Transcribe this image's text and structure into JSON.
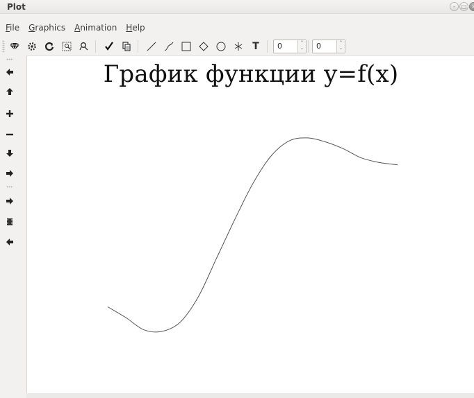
{
  "window": {
    "title": "Plot"
  },
  "menu": [
    "File",
    "Graphics",
    "Animation",
    "Help"
  ],
  "toolbar": {
    "spin1_value": "0",
    "spin2_value": "0",
    "text_tool_label": "T"
  },
  "plot": {
    "title": "График функции y=f(x)",
    "line_color": "#555555"
  },
  "chart_data": {
    "type": "line",
    "title": "График функции y=f(x)",
    "xlabel": "",
    "ylabel": "",
    "grid": false,
    "x": [
      0,
      1,
      2,
      3,
      4,
      5,
      6,
      7,
      8,
      9,
      10,
      11,
      12,
      13,
      14,
      15,
      16
    ],
    "y": [
      -0.58,
      -0.72,
      -0.88,
      -0.9,
      -0.78,
      -0.45,
      0.05,
      0.55,
      1.02,
      1.38,
      1.58,
      1.62,
      1.57,
      1.48,
      1.36,
      1.3,
      1.27
    ]
  }
}
